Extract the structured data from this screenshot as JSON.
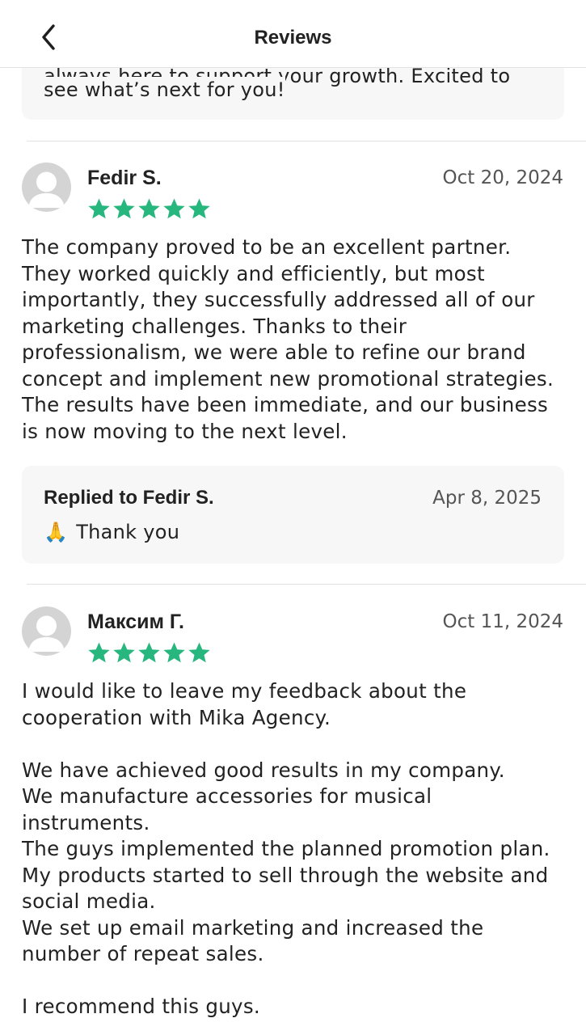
{
  "header": {
    "title": "Reviews"
  },
  "top_reply": {
    "visible_text": "see what’s next for you!",
    "clipped_text": "always here to support your growth. Excited to"
  },
  "reviews": [
    {
      "name": "Fedir S.",
      "date": "Oct 20, 2024",
      "rating": 5,
      "text": "The company proved to be an excellent partner.\nThey worked quickly and efficiently, but most\nimportantly, they successfully addressed all of our\nmarketing challenges. Thanks to their\nprofessionalism, we were able to refine our brand\nconcept and implement new promotional strategies.\nThe results have been immediate, and our business\nis now moving to the next level.",
      "reply": {
        "title": "Replied to Fedir S.",
        "date": "Apr 8, 2025",
        "emoji": "🙏",
        "text": "Thank you"
      }
    },
    {
      "name": "Максим Г.",
      "date": "Oct 11, 2024",
      "rating": 5,
      "text": "I would like to leave my feedback about the\ncooperation with Mika Agency.\n\nWe have achieved good results in my company.\nWe manufacture accessories for musical\ninstruments.\nThe guys implemented the planned promotion plan.\nMy products started to sell through the website and\nsocial media.\nWe set up email marketing and increased the\nnumber of repeat sales.\n\nI recommend this guys."
    }
  ],
  "colors": {
    "star": "#27b77e",
    "reply_bg": "#f7f7f7",
    "divider": "#e2e2e2",
    "avatar": "#d4d4d4"
  },
  "icons": {
    "back": "chevron-left-icon",
    "star": "star-icon",
    "avatar": "default-avatar-icon"
  }
}
